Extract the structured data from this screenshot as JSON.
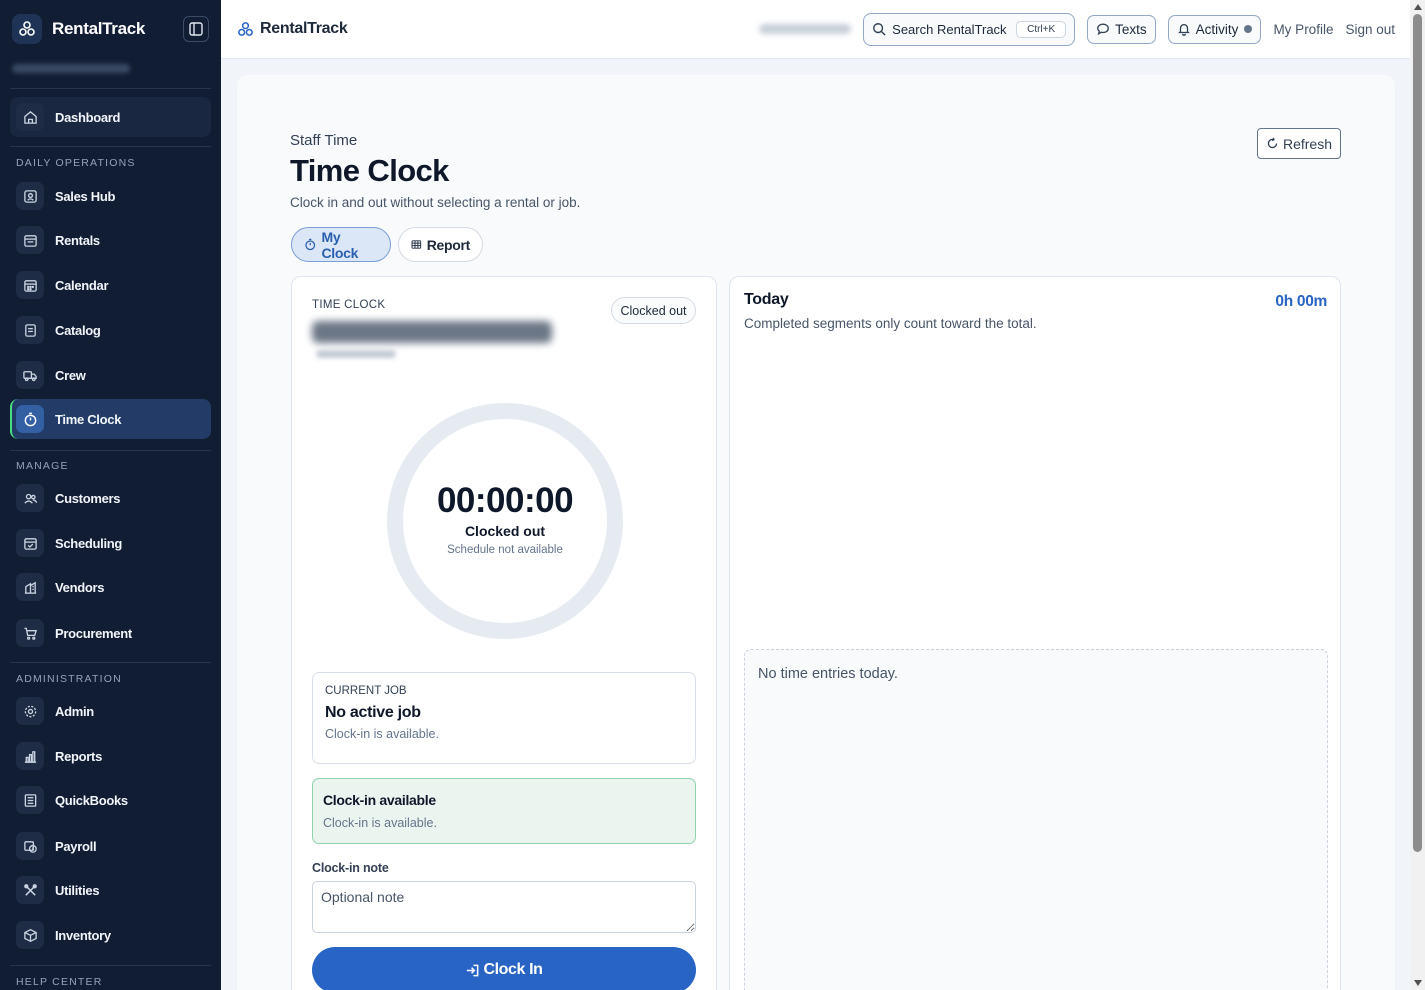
{
  "app": {
    "name": "RentalTrack"
  },
  "sidebar": {
    "sections": {
      "daily_operations": "DAILY OPERATIONS",
      "manage": "MANAGE",
      "administration": "ADMINISTRATION",
      "help_center": "HELP CENTER"
    },
    "items": {
      "dashboard": "Dashboard",
      "sales_hub": "Sales Hub",
      "rentals": "Rentals",
      "calendar": "Calendar",
      "catalog": "Catalog",
      "crew": "Crew",
      "time_clock": "Time Clock",
      "customers": "Customers",
      "scheduling": "Scheduling",
      "vendors": "Vendors",
      "procurement": "Procurement",
      "admin": "Admin",
      "reports": "Reports",
      "quickbooks": "QuickBooks",
      "payroll": "Payroll",
      "utilities": "Utilities",
      "inventory": "Inventory"
    },
    "active_item": "time_clock"
  },
  "topbar": {
    "search_label": "Search RentalTrack",
    "search_shortcut": "Ctrl+K",
    "texts_label": "Texts",
    "activity_label": "Activity",
    "profile_label": "My Profile",
    "signout_label": "Sign out"
  },
  "page": {
    "eyebrow": "Staff Time",
    "title": "Time Clock",
    "subtitle": "Clock in and out without selecting a rental or job.",
    "refresh_label": "Refresh",
    "tabs": [
      {
        "label": "My Clock",
        "active": true
      },
      {
        "label": "Report",
        "active": false
      }
    ]
  },
  "clock_card": {
    "eyebrow": "TIME CLOCK",
    "status_badge": "Clocked out",
    "timer": "00:00:00",
    "timer_status": "Clocked out",
    "schedule_text": "Schedule not available",
    "current_job": {
      "eyebrow": "CURRENT JOB",
      "title": "No active job",
      "subtitle": "Clock-in is available."
    },
    "availability": {
      "title": "Clock-in available",
      "subtitle": "Clock-in is available."
    },
    "note_label": "Clock-in note",
    "note_placeholder": "Optional note",
    "note_value": "",
    "clock_in_label": "Clock In"
  },
  "today_card": {
    "title": "Today",
    "total": "0h 00m",
    "subtitle": "Completed segments only count toward the total.",
    "empty_text": "No time entries today."
  },
  "colors": {
    "sidebar_bg": "#111d33",
    "accent": "#2864c4",
    "available_bg": "#ebf5ef",
    "available_border": "#8fd2ab"
  }
}
